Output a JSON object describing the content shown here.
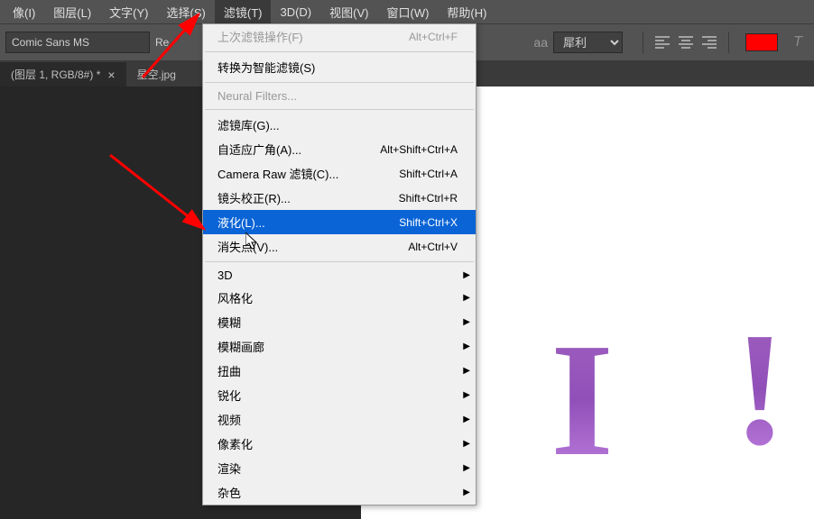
{
  "menubar": {
    "items": [
      "像(I)",
      "图层(L)",
      "文字(Y)",
      "选择(S)",
      "滤镜(T)",
      "3D(D)",
      "视图(V)",
      "窗口(W)",
      "帮助(H)"
    ],
    "active_index": 4
  },
  "toolbar": {
    "font": "Comic Sans MS",
    "style_label": "Re",
    "aa": "aa",
    "sharp": "犀利",
    "color": "#ff0000"
  },
  "tabs": [
    {
      "label": "(图层 1, RGB/8#) *",
      "active": true
    },
    {
      "label": "星空.jpg",
      "active": false
    }
  ],
  "filter_menu": {
    "items": [
      {
        "label": "上次滤镜操作(F)",
        "shortcut": "Alt+Ctrl+F",
        "disabled": true
      },
      {
        "sep": true
      },
      {
        "label": "转换为智能滤镜(S)"
      },
      {
        "sep": true
      },
      {
        "label": "Neural Filters...",
        "disabled": true
      },
      {
        "sep": true
      },
      {
        "label": "滤镜库(G)..."
      },
      {
        "label": "自适应广角(A)...",
        "shortcut": "Alt+Shift+Ctrl+A"
      },
      {
        "label": "Camera Raw 滤镜(C)...",
        "shortcut": "Shift+Ctrl+A"
      },
      {
        "label": "镜头校正(R)...",
        "shortcut": "Shift+Ctrl+R"
      },
      {
        "label": "液化(L)...",
        "shortcut": "Shift+Ctrl+X",
        "highlighted": true
      },
      {
        "label": "消失点(V)...",
        "shortcut": "Alt+Ctrl+V"
      },
      {
        "sep": true
      },
      {
        "label": "3D",
        "submenu": true
      },
      {
        "label": "风格化",
        "submenu": true
      },
      {
        "label": "模糊",
        "submenu": true
      },
      {
        "label": "模糊画廊",
        "submenu": true
      },
      {
        "label": "扭曲",
        "submenu": true
      },
      {
        "label": "锐化",
        "submenu": true
      },
      {
        "label": "视频",
        "submenu": true
      },
      {
        "label": "像素化",
        "submenu": true
      },
      {
        "label": "渲染",
        "submenu": true
      },
      {
        "label": "杂色",
        "submenu": true
      }
    ]
  },
  "canvas": {
    "letter": "I",
    "exclaim": "!"
  }
}
